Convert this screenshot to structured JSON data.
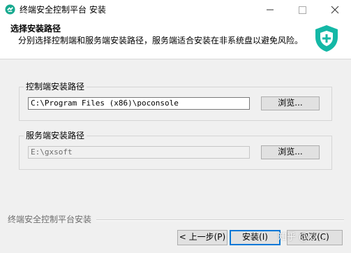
{
  "window": {
    "title": "终端安全控制平台 安装",
    "controls": {
      "minimize": "—",
      "maximize": "☐",
      "close": "✕"
    }
  },
  "header": {
    "title": "选择安装路径",
    "subtitle": "分别选择控制端和服务端安装路径，服务端适合安装在非系统盘以避免风险。"
  },
  "console_group": {
    "label": "控制端安装路径",
    "path": "C:\\Program Files (x86)\\poconsole",
    "browse_label": "浏览..."
  },
  "server_group": {
    "label": "服务端安装路径",
    "path": "E:\\gxsoft",
    "browse_label": "浏览..."
  },
  "footer": {
    "brand": "终端安全控制平台安装",
    "back_label": "< 上一步(P)",
    "install_label": "安装(I)",
    "cancel_label": "取消(C)",
    "watermark": "知乎 @xx..."
  },
  "colors": {
    "accent": "#14b8a6",
    "focus": "#0078d7"
  }
}
